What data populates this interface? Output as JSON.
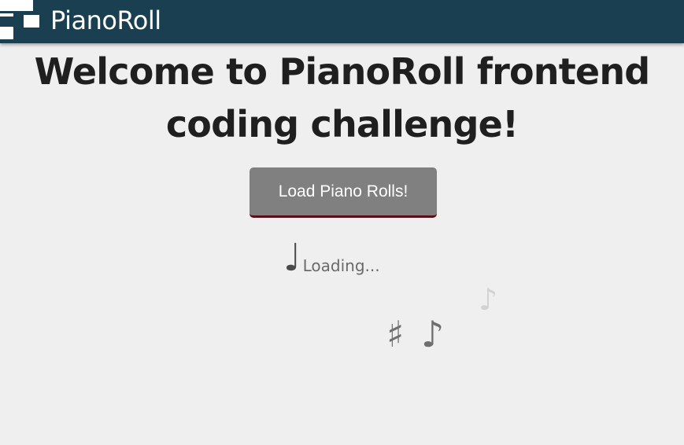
{
  "header": {
    "brand": "PianoRoll",
    "colors": {
      "background": "#1a3f50",
      "text": "#ffffff"
    }
  },
  "main": {
    "title": "Welcome to PianoRoll frontend coding challenge!",
    "load_button_label": "Load Piano Rolls!",
    "loading": {
      "icon": "quarter-note-icon",
      "glyph": "♩",
      "text": "Loading..."
    },
    "decorations": [
      {
        "icon": "sharp-icon",
        "glyph": "♯"
      },
      {
        "icon": "eighth-note-icon",
        "glyph": "♪"
      },
      {
        "icon": "eighth-note-icon",
        "glyph": "♪"
      }
    ]
  },
  "colors": {
    "page_background": "#efefef",
    "button_background": "#808080",
    "button_border": "#5a0d14",
    "title_text": "#1f1f1f"
  }
}
